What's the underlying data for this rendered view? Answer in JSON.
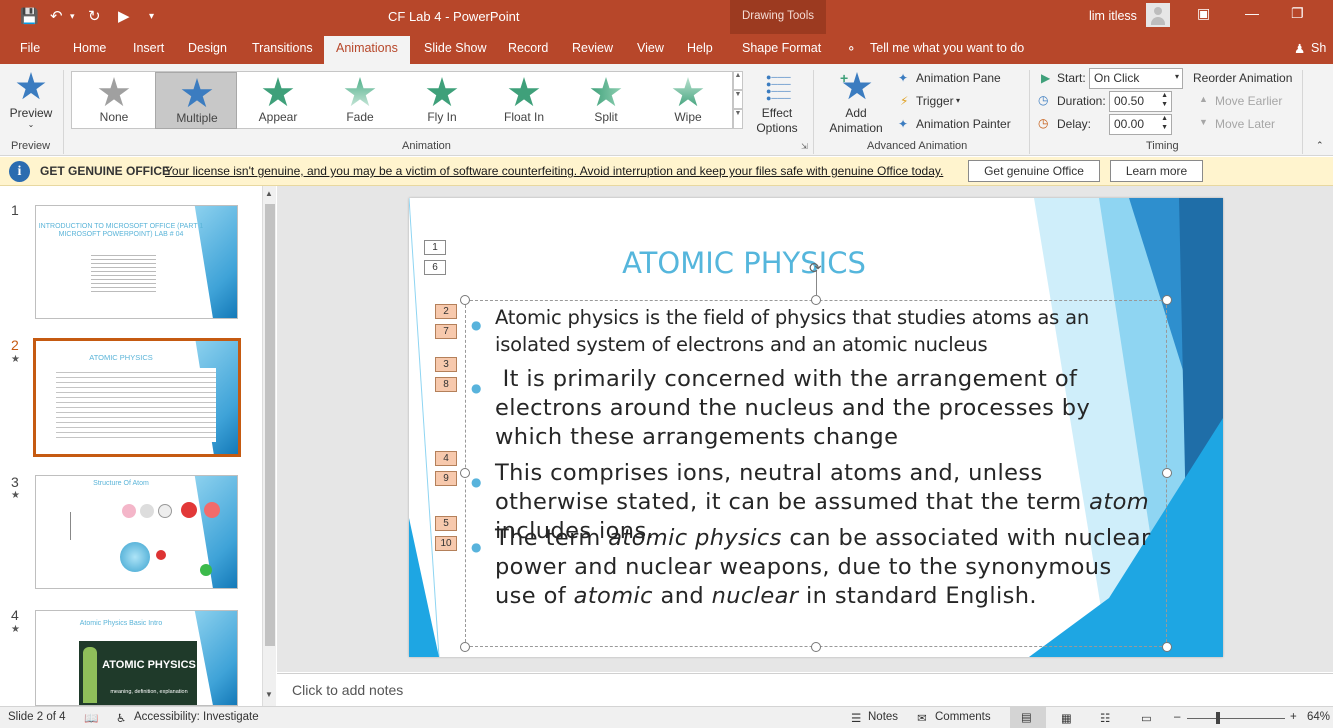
{
  "titlebar": {
    "doc_title": "CF Lab 4  -  PowerPoint",
    "context_tab": "Drawing Tools",
    "user": "lim itless"
  },
  "tabs": [
    "File",
    "Home",
    "Insert",
    "Design",
    "Transitions",
    "Animations",
    "Slide Show",
    "Record",
    "Review",
    "View",
    "Help",
    "Shape Format",
    "Tell me what you want to do",
    "Sh"
  ],
  "ribbon": {
    "preview": {
      "label": "Preview",
      "group": "Preview"
    },
    "gallery": [
      "None",
      "Multiple",
      "Appear",
      "Fade",
      "Fly In",
      "Float In",
      "Split",
      "Wipe"
    ],
    "effect_options": [
      "Effect",
      "Options"
    ],
    "animation_group": "Animation",
    "add_animation": [
      "Add",
      "Animation"
    ],
    "animation_pane": "Animation Pane",
    "trigger": "Trigger",
    "animation_painter": "Animation Painter",
    "advanced_group": "Advanced Animation",
    "start_label": "Start:",
    "start_value": "On Click",
    "duration_label": "Duration:",
    "duration_value": "00.50",
    "delay_label": "Delay:",
    "delay_value": "00.00",
    "reorder": "Reorder Animation",
    "move_earlier": "Move Earlier",
    "move_later": "Move Later",
    "timing_group": "Timing"
  },
  "infobar": {
    "title": "GET GENUINE OFFICE",
    "message": "Your license isn't genuine, and you may be a victim of software counterfeiting. Avoid interruption and keep your files safe with genuine Office today.",
    "btn_genuine": "Get genuine Office",
    "btn_learn": "Learn more"
  },
  "thumbnails": [
    {
      "num": "1",
      "title": "INTRODUCTION TO MICROSOFT OFFICE (PART 1 MICROSOFT POWERPOINT) LAB # 04"
    },
    {
      "num": "2",
      "title": "ATOMIC PHYSICS"
    },
    {
      "num": "3",
      "title": "Structure Of Atom"
    },
    {
      "num": "4",
      "title": "Atomic Physics Basic Intro",
      "banner": "ATOMIC PHYSICS",
      "banner_sub": "meaning, definition, explanation"
    }
  ],
  "slide": {
    "title": "ATOMIC PHYSICS",
    "title_tags": [
      "1",
      "6"
    ],
    "paragraphs": [
      {
        "text": "Atomic physics is the field of physics that studies atoms as an isolated system of electrons and an atomic nucleus",
        "tags": [
          "2",
          "7"
        ]
      },
      {
        "text": " It is primarily concerned with the arrangement of electrons around the nucleus and the processes by which these arrangements change",
        "tags": [
          "3",
          "8"
        ]
      },
      {
        "text_a": "This comprises ions, neutral atoms and, unless otherwise stated, it can be assumed that the term ",
        "em": "atom",
        "text_b": " includes ions.",
        "tags": [
          "4",
          "9"
        ]
      },
      {
        "text_a": "The term ",
        "em_a": "atomic physics",
        "text_b": " can be associated with nuclear power and nuclear weapons, due to the synonymous use of ",
        "em_b": "atomic",
        "text_c": " and ",
        "em_c": "nuclear",
        "text_d": " in standard English.",
        "tags": [
          "5",
          "10"
        ]
      }
    ]
  },
  "notes_placeholder": "Click to add notes",
  "statusbar": {
    "slide_info": "Slide 2 of 4",
    "accessibility": "Accessibility: Investigate",
    "notes": "Notes",
    "comments": "Comments",
    "zoom": "64%"
  },
  "colors": {
    "accent": "#b7472a",
    "title_blue": "#55b6dc",
    "tag_orange": "#f7c9ad"
  }
}
